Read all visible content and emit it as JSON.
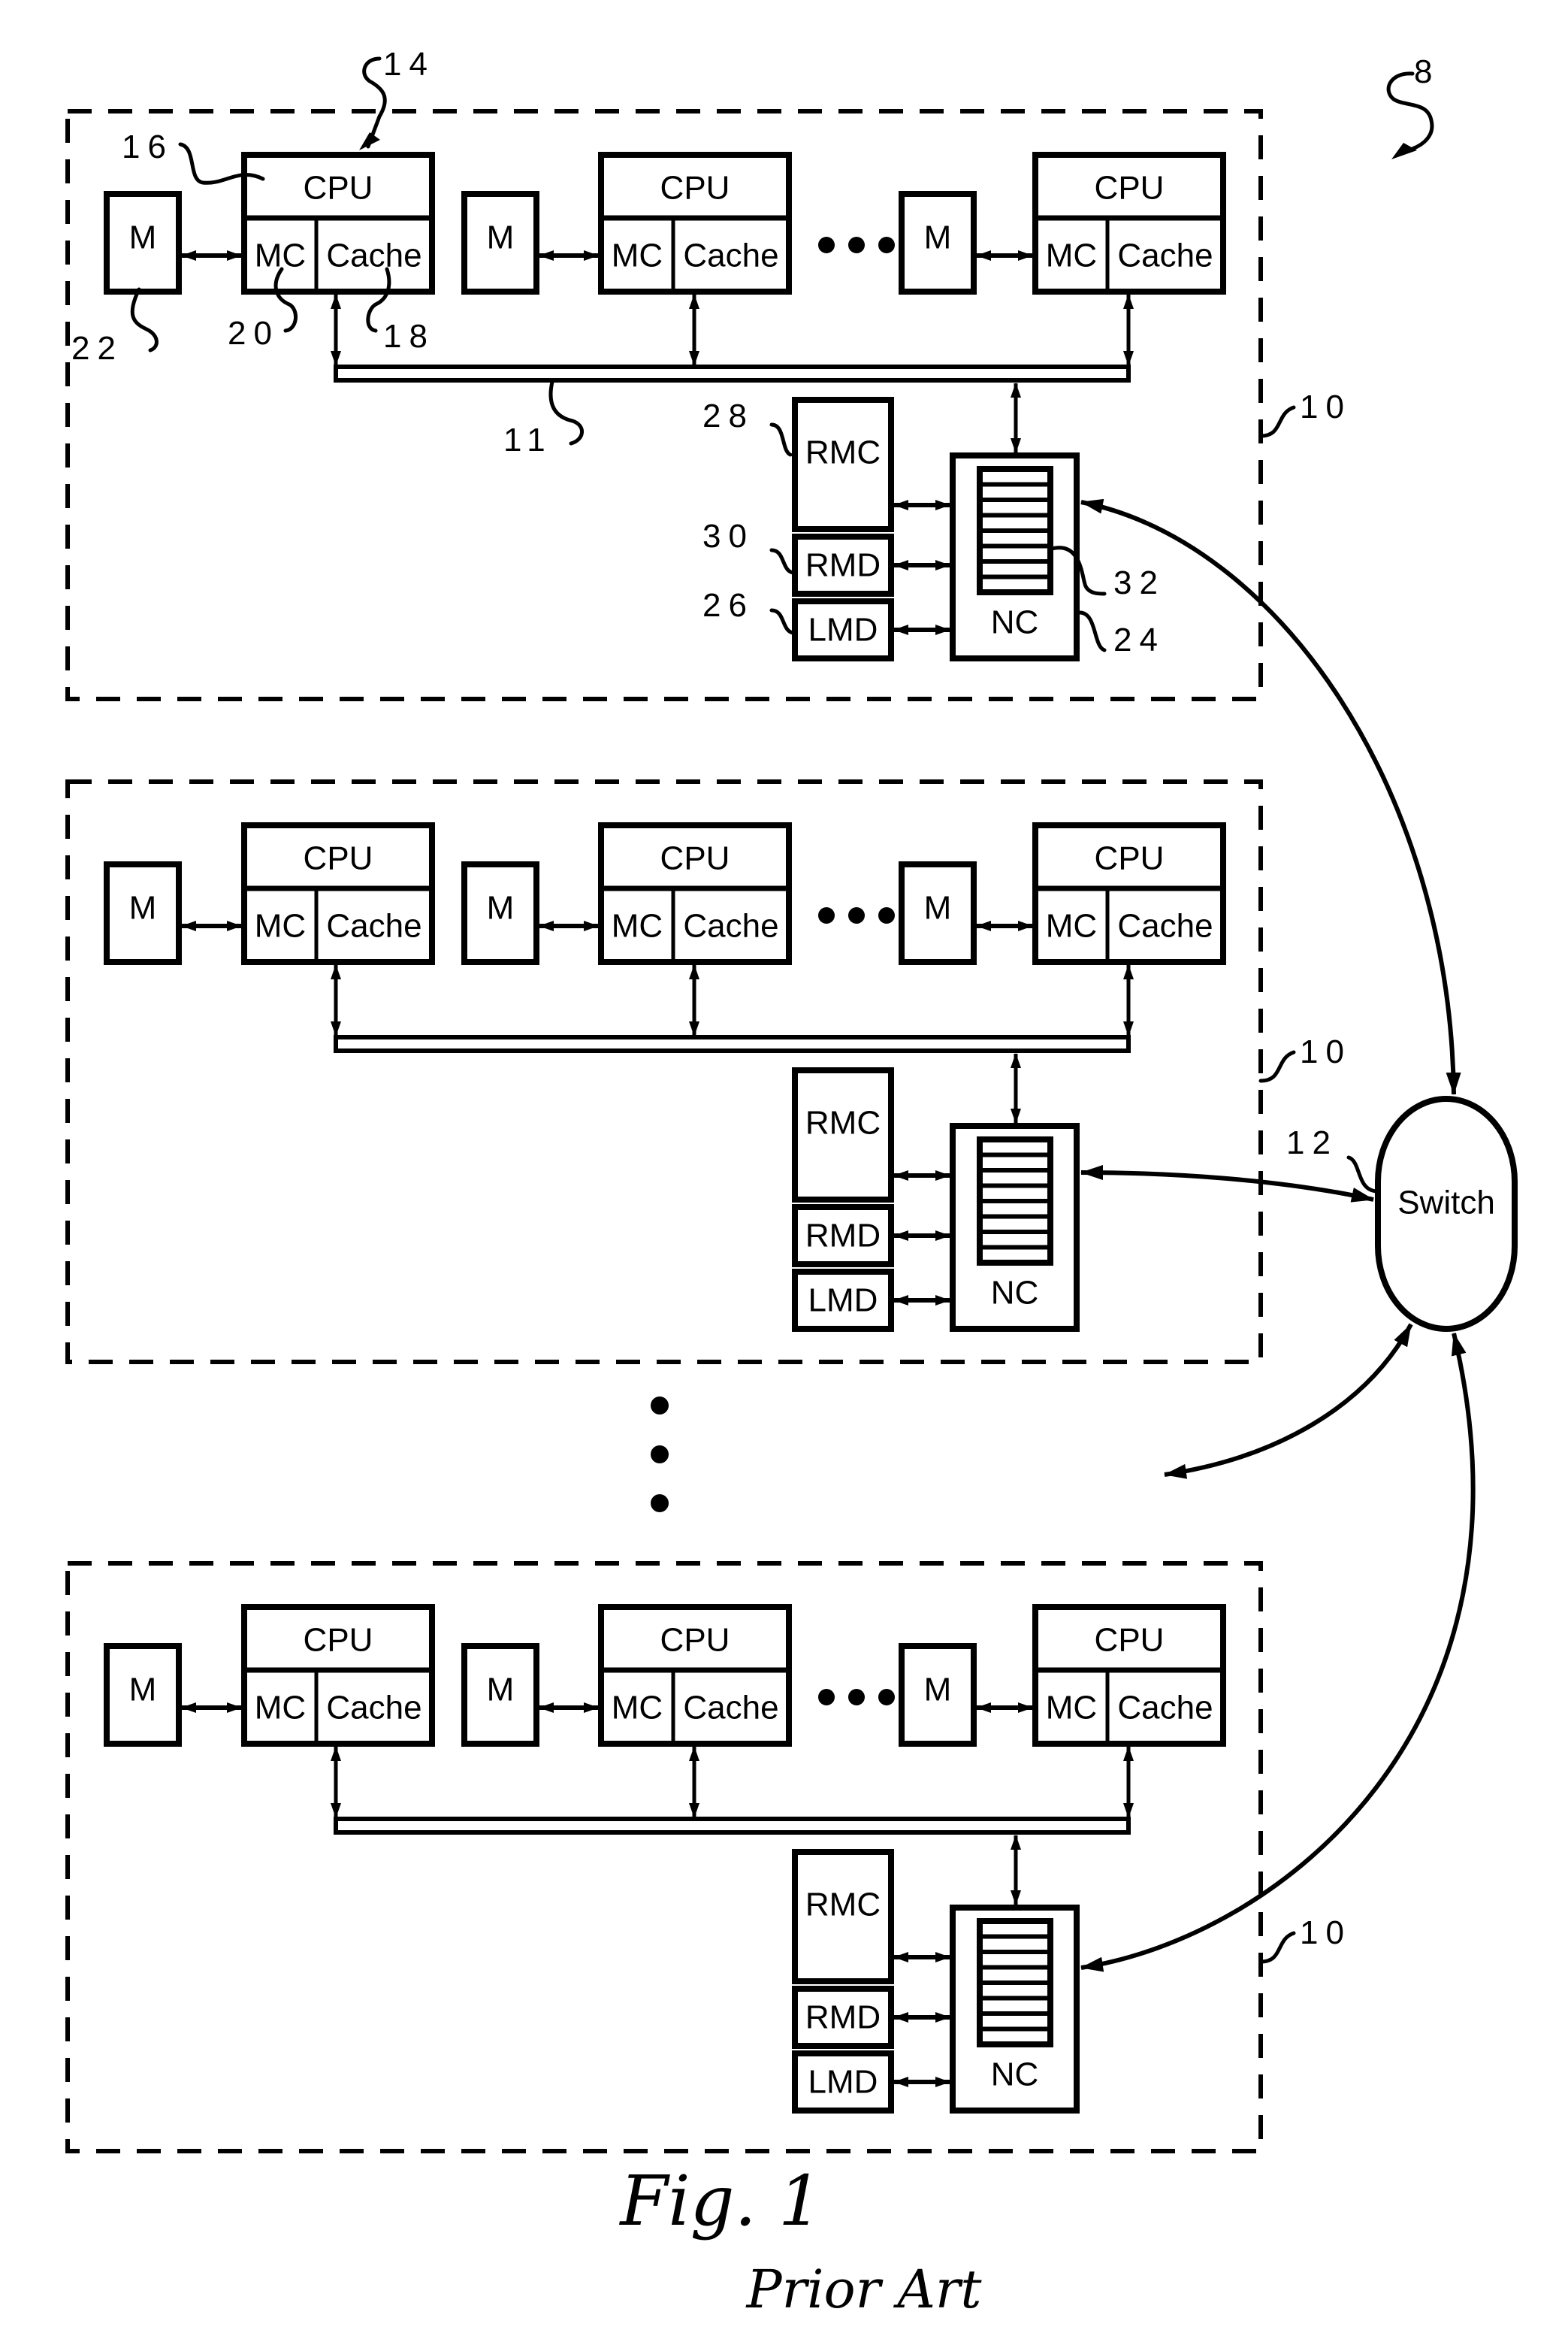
{
  "figure": {
    "title": "Fig.  1",
    "subtitle": "Prior Art",
    "system_ref": "8"
  },
  "labels": {
    "cpu": "CPU",
    "mc": "MC",
    "cache": "Cache",
    "memory": "M",
    "rmc": "RMC",
    "rmd": "RMD",
    "lmd": "LMD",
    "nc": "NC",
    "switch": "Switch"
  },
  "node_count_shown": 3,
  "processors_per_node_shown": 3,
  "nc_buffer_entries": 8,
  "reference_numerals": {
    "node": "10",
    "interconnect_bus": "11",
    "switch": "12",
    "processor": "14",
    "cpu_core": "16",
    "cache": "18",
    "memory_controller": "20",
    "memory": "22",
    "node_controller": "24",
    "lmd": "26",
    "rmc": "28",
    "rmd": "30",
    "nc_buffer": "32"
  },
  "ellipsis": "• • •"
}
